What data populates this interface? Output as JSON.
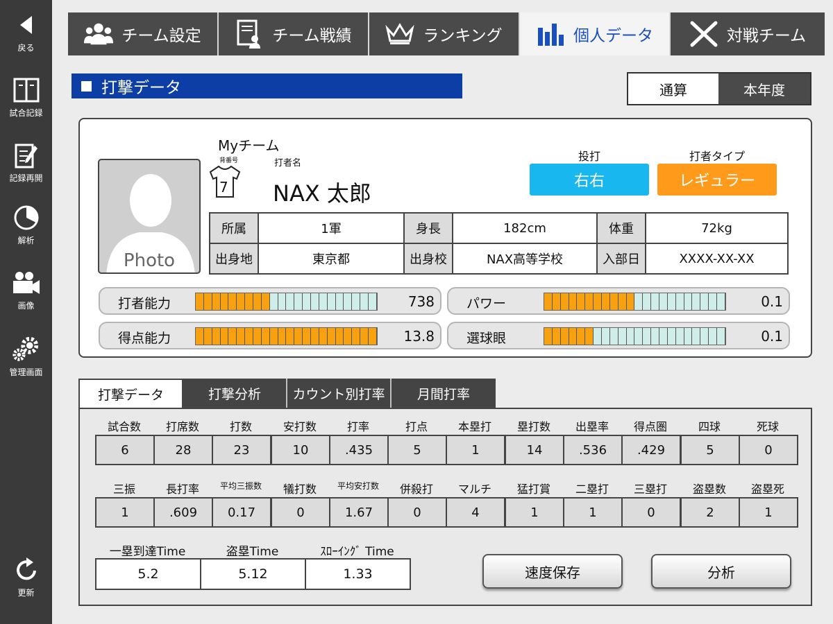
{
  "sidebar": {
    "back": {
      "label": "戻る",
      "icon": "back-arrow-icon"
    },
    "items": [
      {
        "label": "試合記録",
        "icon": "book-icon"
      },
      {
        "label": "記録再開",
        "icon": "note-edit-icon"
      },
      {
        "label": "解析",
        "icon": "pie-chart-icon"
      },
      {
        "label": "画像",
        "icon": "video-camera-icon"
      },
      {
        "label": "管理画面",
        "icon": "gears-icon"
      }
    ],
    "refresh": {
      "label": "更新",
      "icon": "refresh-icon"
    }
  },
  "top_tabs": [
    {
      "label": "チーム設定",
      "icon": "team-people-icon"
    },
    {
      "label": "チーム戦績",
      "icon": "document-team-icon"
    },
    {
      "label": "ランキング",
      "icon": "crown-icon"
    },
    {
      "label": "個人データ",
      "icon": "bar-chart-icon",
      "active": true
    },
    {
      "label": "対戦チーム",
      "icon": "crossed-bats-icon"
    }
  ],
  "section": {
    "title": "打撃データ",
    "period_options": [
      "通算",
      "本年度"
    ],
    "period_selected": "通算"
  },
  "player": {
    "team": "Myチーム",
    "number_label": "背番号",
    "name_label": "打者名",
    "number": "7",
    "name": "NAX 太郎",
    "photo_label": "Photo",
    "throw_bat_label": "投打",
    "throw_bat": "右右",
    "batter_type_label": "打者タイプ",
    "batter_type": "レギュラー",
    "info_rows": [
      [
        {
          "h": "所属",
          "v": "1軍"
        },
        {
          "h": "身長",
          "v": "182cm"
        },
        {
          "h": "体重",
          "v": "72kg"
        }
      ],
      [
        {
          "h": "出身地",
          "v": "東京都"
        },
        {
          "h": "出身校",
          "v": "NAX高等学校"
        },
        {
          "h": "入部日",
          "v": "XXXX-XX-XX"
        }
      ]
    ],
    "meters": [
      {
        "label": "打者能力",
        "value": "738",
        "filled": 9,
        "segments": 22
      },
      {
        "label": "パワー",
        "value": "0.1",
        "filled": 11,
        "segments": 22
      },
      {
        "label": "得点能力",
        "value": "13.8",
        "filled": 22,
        "segments": 22
      },
      {
        "label": "選球眼",
        "value": "0.1",
        "filled": 6,
        "segments": 22
      }
    ]
  },
  "colors": {
    "accent_blue": "#0d3ea6",
    "throw_bat_button": "#19b7f0",
    "batter_type_button": "#ff9a1a",
    "meter_filled": "#f6a10d",
    "meter_empty": "#cfeee9"
  },
  "data_tabs": [
    "打撃データ",
    "打撃分析",
    "カウント別打率",
    "月間打率"
  ],
  "stats_row1": [
    {
      "label": "試合数",
      "value": "6"
    },
    {
      "label": "打席数",
      "value": "28"
    },
    {
      "label": "打数",
      "value": "23"
    },
    {
      "label": "安打数",
      "value": "10"
    },
    {
      "label": "打率",
      "value": ".435"
    },
    {
      "label": "打点",
      "value": "5"
    },
    {
      "label": "本塁打",
      "value": "1"
    },
    {
      "label": "塁打数",
      "value": "14"
    },
    {
      "label": "出塁率",
      "value": ".536"
    },
    {
      "label": "得点圏",
      "value": ".429"
    },
    {
      "label": "四球",
      "value": "5"
    },
    {
      "label": "死球",
      "value": "0"
    }
  ],
  "stats_row2": [
    {
      "label": "三振",
      "value": "1"
    },
    {
      "label": "長打率",
      "value": ".609"
    },
    {
      "label": "平均三振数",
      "value": "0.17"
    },
    {
      "label": "犠打数",
      "value": "0"
    },
    {
      "label": "平均安打数",
      "value": "1.67"
    },
    {
      "label": "併殺打",
      "value": "0"
    },
    {
      "label": "マルチ",
      "value": "4"
    },
    {
      "label": "猛打賞",
      "value": "1"
    },
    {
      "label": "二塁打",
      "value": "1"
    },
    {
      "label": "三塁打",
      "value": "0"
    },
    {
      "label": "盗塁数",
      "value": "2"
    },
    {
      "label": "盗塁死",
      "value": "1"
    }
  ],
  "times": [
    {
      "label": "一塁到達Time",
      "value": "5.2"
    },
    {
      "label": "盗塁Time",
      "value": "5.12"
    },
    {
      "label": "ｽﾛｰｲﾝｸﾞ Time",
      "value": "1.33"
    }
  ],
  "buttons": {
    "save": "速度保存",
    "analyze": "分析"
  }
}
